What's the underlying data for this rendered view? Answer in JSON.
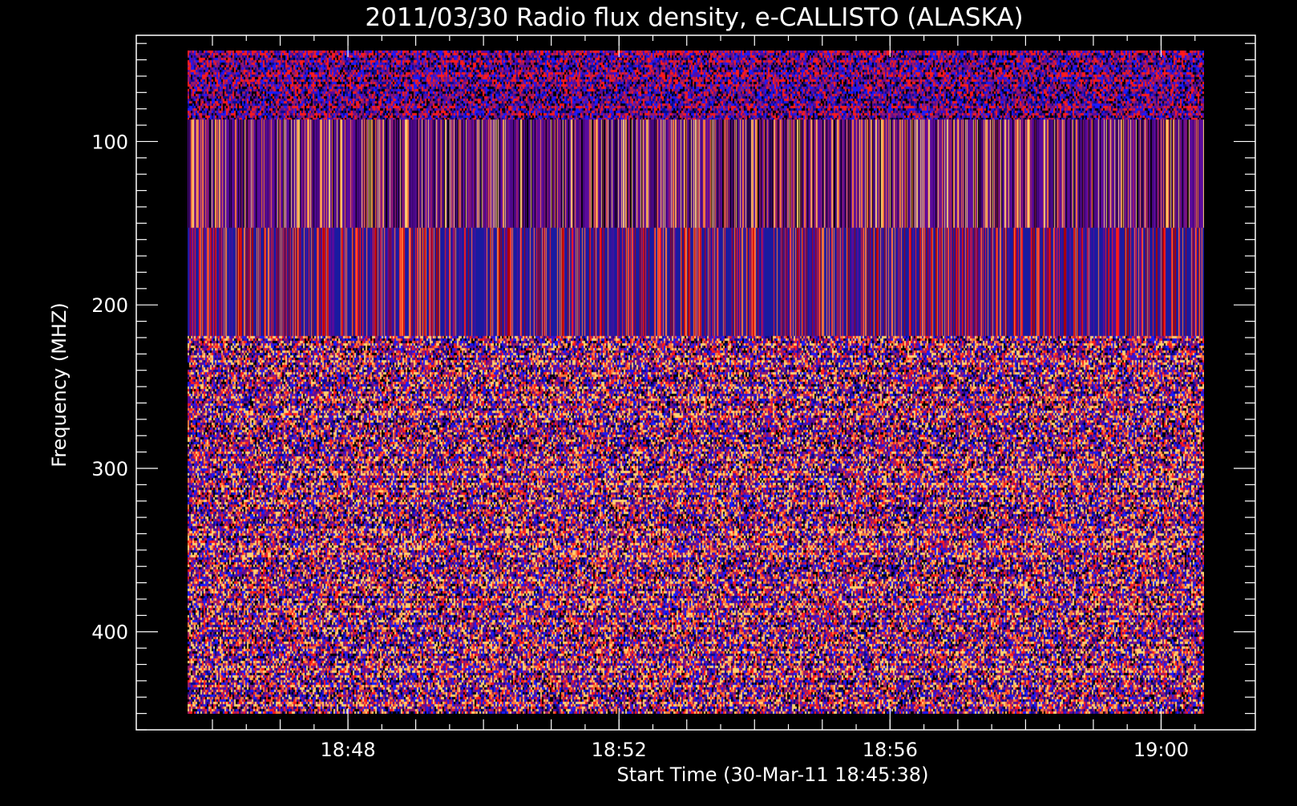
{
  "chart_data": {
    "type": "heatmap",
    "title": "2011/03/30  Radio flux density, e-CALLISTO (ALASKA)",
    "xlabel": "Start Time (30-Mar-11 18:45:38)",
    "ylabel": "Frequency (MHZ)",
    "x_start": "18:45:38",
    "x_range": [
      "18:45:38",
      "19:00:38"
    ],
    "y_range": [
      45.5,
      455
    ],
    "ylim": [
      35,
      460
    ],
    "y_axis_inverted": true,
    "x_ticks": [
      {
        "label": "18:48"
      },
      {
        "label": "18:52"
      },
      {
        "label": "18:56"
      },
      {
        "label": "19:00"
      }
    ],
    "y_ticks": [
      {
        "value": 100,
        "label": "100"
      },
      {
        "value": 200,
        "label": "200"
      },
      {
        "value": 300,
        "label": "300"
      },
      {
        "value": 400,
        "label": "400"
      }
    ],
    "colormap": [
      "#000000",
      "#0a0a8c",
      "#1a1aff",
      "#5a0a9c",
      "#9a1a6a",
      "#ff1a1a",
      "#ff7a3a",
      "#ffd070"
    ],
    "bands": [
      {
        "from": 45.5,
        "to": 88,
        "pattern": "noise",
        "palette": [
          "#000000",
          "#0a0a8c",
          "#1a1aff",
          "#5a0a9c",
          "#9a1a6a",
          "#ff1a1a"
        ]
      },
      {
        "from": 88,
        "to": 155,
        "pattern": "stripes",
        "palette": [
          "#5a0a9c",
          "#5a0a9c",
          "#5a0a9c",
          "#3a0570",
          "#000000",
          "#ff7a3a",
          "#ffd070",
          "#9a1a6a"
        ]
      },
      {
        "from": 155,
        "to": 222,
        "pattern": "stripes",
        "palette": [
          "#1a1aa0",
          "#1a1aa0",
          "#1a1aa0",
          "#1a1aa0",
          "#b00000",
          "#ff1a1a",
          "#5a0a9c",
          "#ff7a3a"
        ]
      },
      {
        "from": 222,
        "to": 455,
        "pattern": "noise",
        "palette": [
          "#000000",
          "#0a0a8c",
          "#1a1aff",
          "#5a0a9c",
          "#9a1a6a",
          "#ff1a1a",
          "#ff7a3a",
          "#ffd070"
        ]
      }
    ]
  }
}
